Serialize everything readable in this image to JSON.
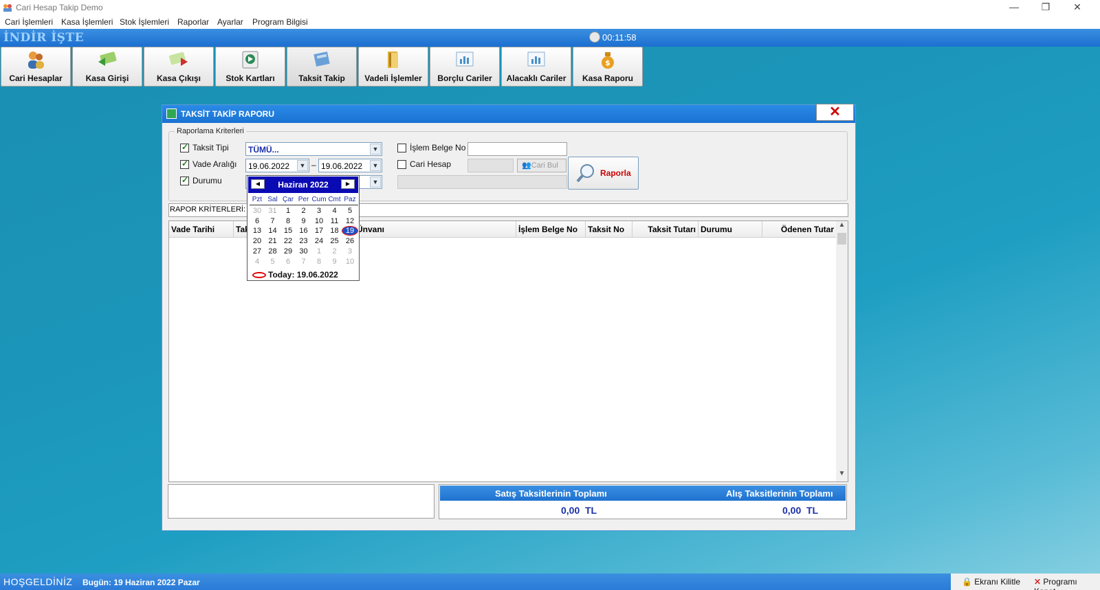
{
  "window": {
    "title": "Cari Hesap Takip Demo",
    "controls": [
      "—",
      "❐",
      "✕"
    ]
  },
  "menu": [
    "Cari İşlemleri",
    "Kasa İşlemleri",
    "Stok İşlemleri",
    "Raporlar",
    "Ayarlar",
    "Program Bilgisi"
  ],
  "brand": "İNDİR İŞTE",
  "clock": "00:11:58",
  "toolbar": [
    {
      "label": "Cari Hesaplar",
      "icon": "users-icon",
      "color": "#e89a3c"
    },
    {
      "label": "Kasa Girişi",
      "icon": "money-in-icon",
      "color": "#5ab04a"
    },
    {
      "label": "Kasa Çıkışı",
      "icon": "money-out-icon",
      "color": "#d9534f"
    },
    {
      "label": "Stok Kartları",
      "icon": "stock-icon",
      "color": "#2e8b57"
    },
    {
      "label": "Taksit Takip",
      "icon": "installment-icon",
      "color": "#4a78b0"
    },
    {
      "label": "Vadeli İşlemler",
      "icon": "folder-icon",
      "color": "#e2b13c"
    },
    {
      "label": "Borçlu Cariler",
      "icon": "chart-icon",
      "color": "#4a90c8"
    },
    {
      "label": "Alacaklı Cariler",
      "icon": "chart-icon",
      "color": "#4a90c8"
    },
    {
      "label": "Kasa Raporu",
      "icon": "money-bag-icon",
      "color": "#e8a020"
    }
  ],
  "dialog": {
    "title": "TAKSİT TAKİP RAPORU",
    "close": "✕",
    "criteria_legend": "Raporlama Kriterleri",
    "taksit_tipi": {
      "label": "Taksit Tipi",
      "value": "TÜMÜ..."
    },
    "vade_araligi": {
      "label": "Vade Aralığı",
      "from": "19.06.2022",
      "to": "19.06.2022",
      "sep": "–"
    },
    "durumu": {
      "label": "Durumu"
    },
    "islem_belge_no": {
      "label": "İşlem Belge No"
    },
    "cari_hesap": {
      "label": "Cari Hesap",
      "button": "Cari Bul"
    },
    "rapor_button": "Raporla",
    "rapor_kriterleri": "RAPOR KRİTERLERİ: T",
    "columns": [
      "Vade Tarihi",
      "Tak",
      "Ünvanı",
      "İşlem Belge No",
      "Taksit No",
      "Taksit Tutarı",
      "Durumu",
      "Ödenen Tutar"
    ],
    "totals": {
      "satis_label": "Satış Taksitlerinin Toplamı",
      "alis_label": "Alış Taksitlerinin Toplamı",
      "satis_value": "0,00",
      "alis_value": "0,00",
      "currency": "TL"
    }
  },
  "calendar": {
    "title": "Haziran 2022",
    "days_of_week": [
      "Pzt",
      "Sal",
      "Çar",
      "Per",
      "Cum",
      "Cmt",
      "Paz"
    ],
    "weeks": [
      [
        "30",
        "31",
        "1",
        "2",
        "3",
        "4",
        "5"
      ],
      [
        "6",
        "7",
        "8",
        "9",
        "10",
        "11",
        "12"
      ],
      [
        "13",
        "14",
        "15",
        "16",
        "17",
        "18",
        "19"
      ],
      [
        "20",
        "21",
        "22",
        "23",
        "24",
        "25",
        "26"
      ],
      [
        "27",
        "28",
        "29",
        "30",
        "1",
        "2",
        "3"
      ],
      [
        "4",
        "5",
        "6",
        "7",
        "8",
        "9",
        "10"
      ]
    ],
    "selected": "19",
    "today_text": "Today: 19.06.2022"
  },
  "status": {
    "welcome": "HOŞGELDİNİZ",
    "date": "Bugün: 19 Haziran 2022 Pazar",
    "lock": "Ekranı Kilitle",
    "exit": "Programı Kapat"
  }
}
